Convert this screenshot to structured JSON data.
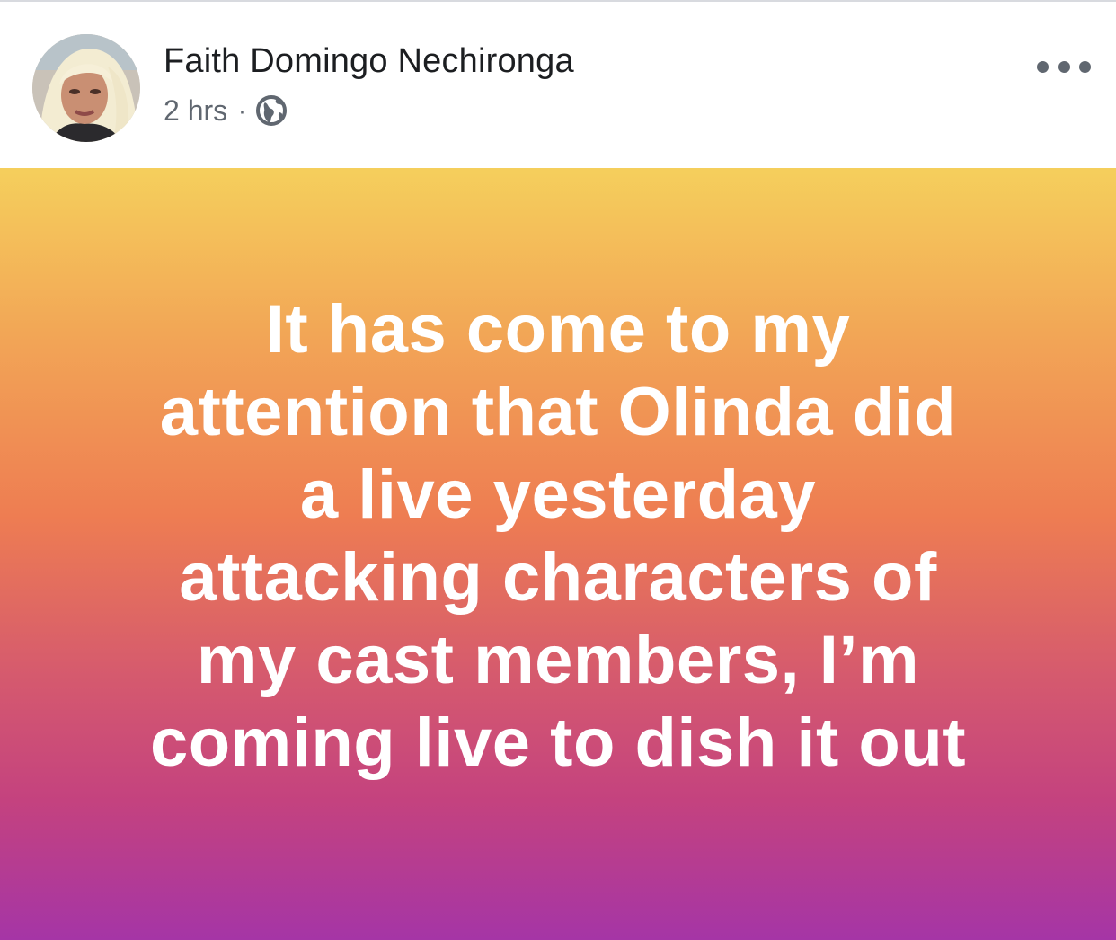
{
  "post": {
    "author_name": "Faith Domingo Nechironga",
    "timestamp": "2 hrs",
    "separator": "·",
    "audience_icon": "globe-icon",
    "more_icon": "more-dots-icon",
    "body_lines": [
      "It has come to my",
      "attention that Olinda did",
      "a live yesterday",
      "attacking characters of",
      "my cast members, I’m",
      "coming live to dish it out"
    ],
    "background_colors": [
      "#f5cf5c",
      "#ee7d52",
      "#c4427f",
      "#a535a6"
    ],
    "text_color": "#ffffff"
  }
}
